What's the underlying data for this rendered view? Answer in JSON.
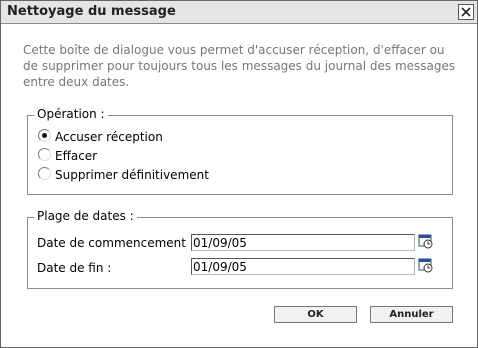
{
  "dialog": {
    "title": "Nettoyage du message",
    "intro": "Cette boîte de dialogue vous permet d'accuser réception, d'effacer ou de supprimer pour toujours tous les messages du journal des messages entre deux dates."
  },
  "operation": {
    "legend": "Opération :",
    "options": [
      {
        "label": "Accuser réception",
        "selected": true
      },
      {
        "label": "Effacer",
        "selected": false
      },
      {
        "label": "Supprimer définitivement",
        "selected": false
      }
    ]
  },
  "date_range": {
    "legend": "Plage de dates :",
    "start_label": "Date de commencement :",
    "start_value": "01/09/05",
    "end_label": "Date de fin :",
    "end_value": "01/09/05",
    "calendar_icon": "calendar-clock-icon"
  },
  "buttons": {
    "ok": "OK",
    "cancel": "Annuler"
  },
  "colors": {
    "titlebar": "#e4e4e4",
    "intro_text": "#777777",
    "border": "#8c8c8c"
  }
}
